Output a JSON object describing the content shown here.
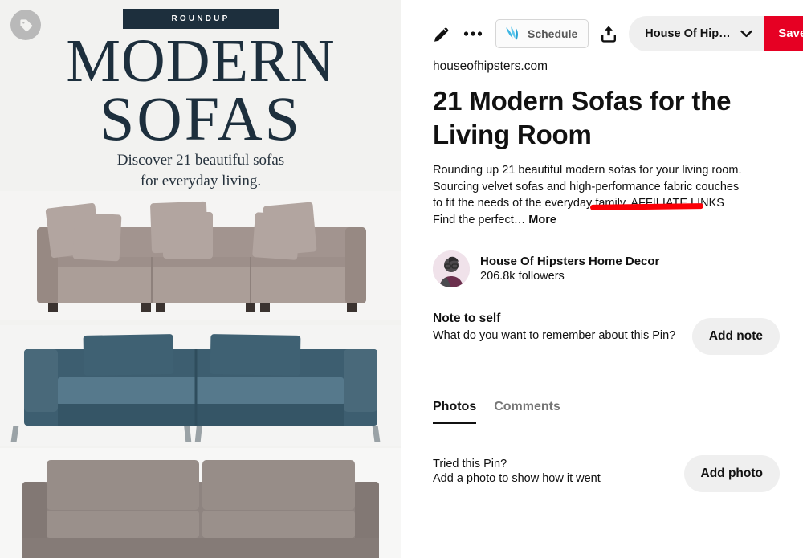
{
  "pin_image": {
    "badge_label": "ROUNDUP",
    "title_line1": "MODERN",
    "title_line2": "SOFAS",
    "subtitle_line1": "Discover 21 beautiful sofas",
    "subtitle_line2": "for everyday living.",
    "tag_icon": "price-tag-icon",
    "sofas": [
      {
        "name": "gray modular sectional sofa",
        "color": "#9e918f"
      },
      {
        "name": "teal velvet two-seat sofa",
        "color": "#3c5d70"
      },
      {
        "name": "taupe fabric sofa",
        "color": "#8d8380"
      }
    ]
  },
  "toolbar": {
    "edit_icon": "pencil-icon",
    "more_icon": "ellipsis-icon",
    "schedule_label": "Schedule",
    "schedule_icon": "tailwind-logo-icon",
    "share_icon": "share-upload-icon",
    "board_name": "House Of Hipsters ...",
    "board_chevron_icon": "chevron-down-icon",
    "save_label": "Save",
    "save_color": "#e60023"
  },
  "detail": {
    "source_link": "houseofhipsters.com",
    "headline": "21 Modern Sofas for the Living Room",
    "description": "Rounding up 21 beautiful modern sofas for your living room. Sourcing velvet sofas and high-performance fabric couches to fit the needs of the everyday family. AFFILIATE LINKS Find the perfect…",
    "more_label": "More",
    "annotation": {
      "type": "underline",
      "target_text": "AFFILIATE LINKS",
      "color": "#fb0007"
    },
    "profile": {
      "name": "House Of Hipsters Home Decor",
      "followers": "206.8k followers",
      "avatar": "user-avatar"
    },
    "note": {
      "title": "Note to self",
      "prompt": "What do you want to remember about this Pin?",
      "button_label": "Add note"
    },
    "tabs": [
      {
        "label": "Photos",
        "active": true
      },
      {
        "label": "Comments",
        "active": false
      }
    ],
    "tried": {
      "title": "Tried this Pin?",
      "subtitle": "Add a photo to show how it went",
      "button_label": "Add photo"
    }
  }
}
